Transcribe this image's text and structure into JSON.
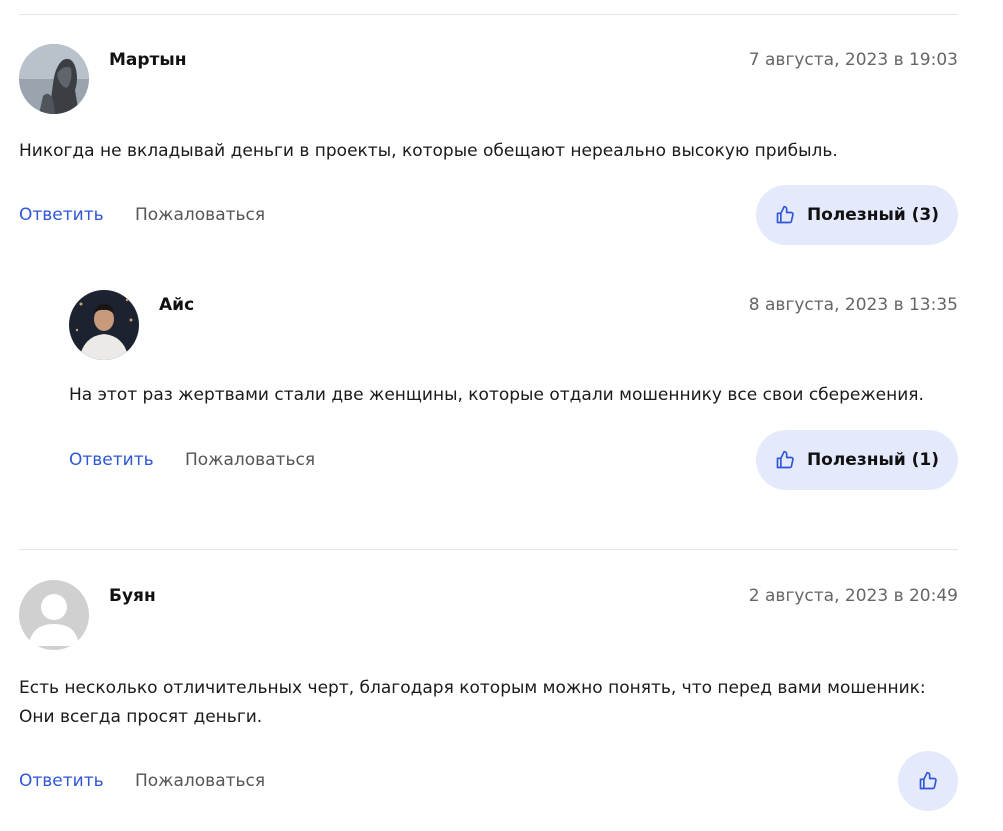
{
  "comments": [
    {
      "author": "Мартын",
      "date": "7 августа, 2023 в 19:03",
      "text": "Никогда не вкладывай деньги в проекты, которые обещают нереально высокую прибыль.",
      "reply_label": "Ответить",
      "report_label": "Пожаловаться",
      "helpful_label": "Полезный (3)",
      "avatar_icon": "statue-photo-avatar",
      "replies": [
        {
          "author": "Айс",
          "date": "8 августа, 2023 в 13:35",
          "text": "На этот раз жертвами стали две женщины, которые отдали мошеннику все свои сбережения.",
          "reply_label": "Ответить",
          "report_label": "Пожаловаться",
          "helpful_label": "Полезный (1)",
          "avatar_icon": "person-photo-avatar"
        }
      ]
    },
    {
      "author": "Буян",
      "date": "2 августа, 2023 в 20:49",
      "text_line1": "Есть несколько отличительных черт, благодаря которым можно понять, что перед вами мошенник:",
      "text_line2": "Они всегда просят деньги.",
      "reply_label": "Ответить",
      "report_label": "Пожаловаться",
      "avatar_icon": "default-user-avatar",
      "helpful_icon": "thumbs-up-icon"
    }
  ],
  "colors": {
    "link": "#2e56d6",
    "helpful_bg": "#e4eafc",
    "muted": "#666666",
    "divider": "#e6e6e6"
  }
}
